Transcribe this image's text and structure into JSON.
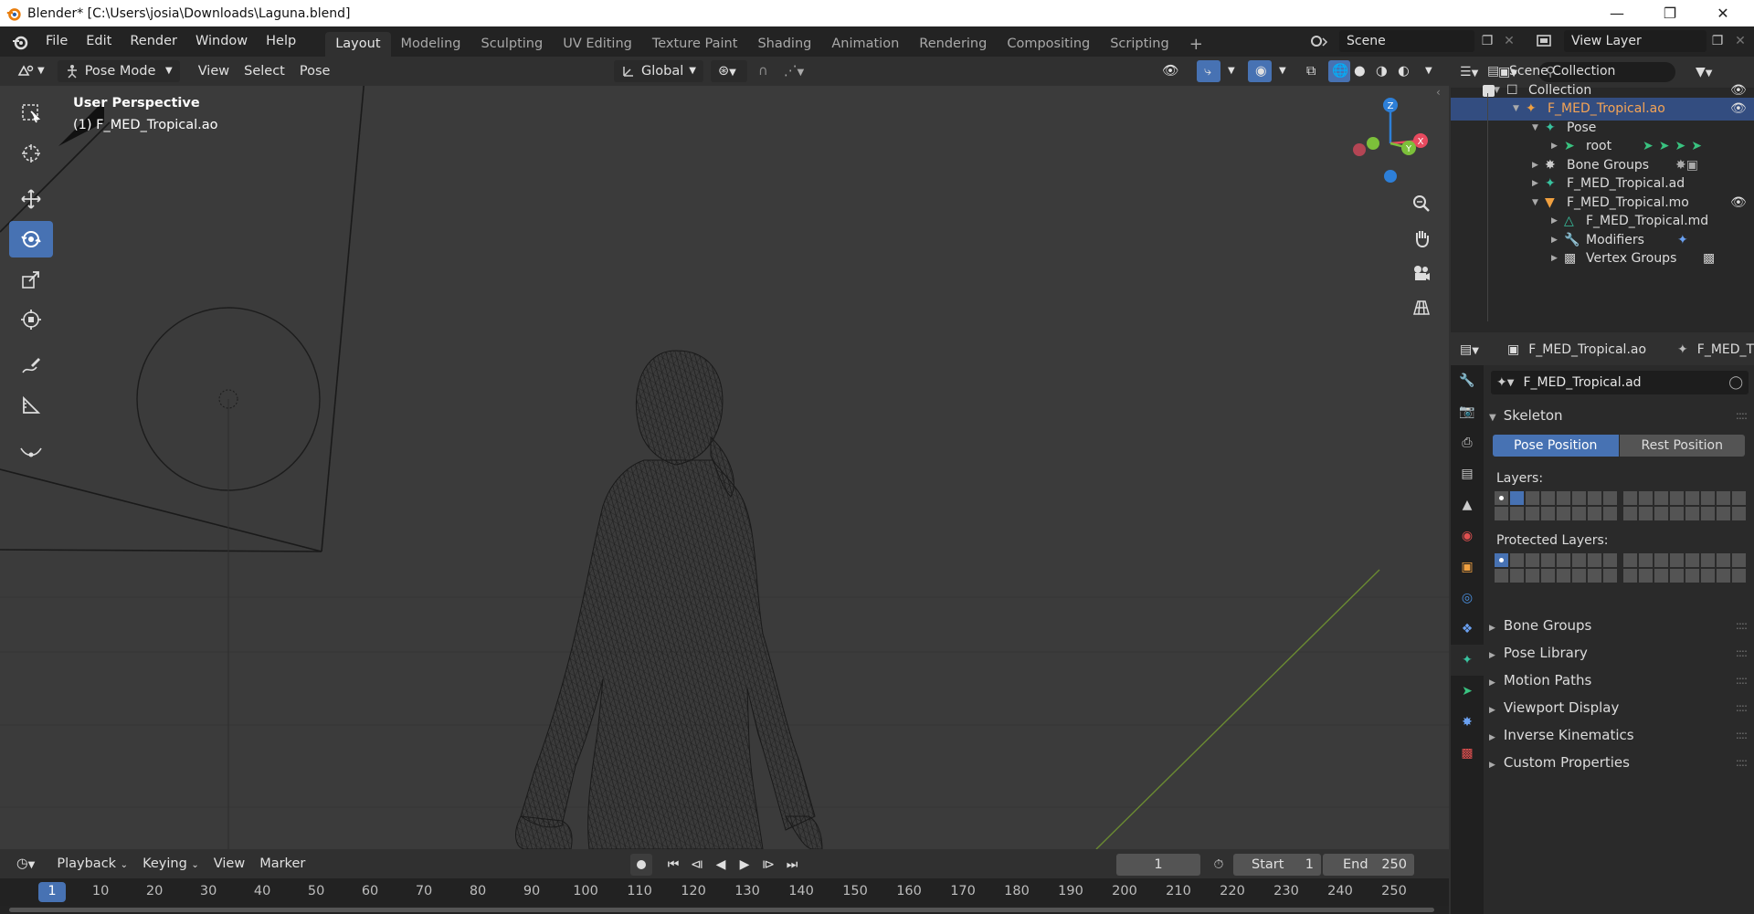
{
  "window": {
    "title": "Blender* [C:\\Users\\josia\\Downloads\\Laguna.blend]"
  },
  "menu": [
    "File",
    "Edit",
    "Render",
    "Window",
    "Help"
  ],
  "workspaces": [
    "Layout",
    "Modeling",
    "Sculpting",
    "UV Editing",
    "Texture Paint",
    "Shading",
    "Animation",
    "Rendering",
    "Compositing",
    "Scripting"
  ],
  "active_workspace": "Layout",
  "scene_name": "Scene",
  "view_layer_name": "View Layer",
  "viewport_header": {
    "mode": "Pose Mode",
    "menus": [
      "View",
      "Select",
      "Pose"
    ],
    "orientation": "Global"
  },
  "viewport": {
    "perspective_label": "User Perspective",
    "object_label": "(1) F_MED_Tropical.ao",
    "gizmo_axes": [
      "Z",
      "Y",
      "X"
    ]
  },
  "outliner": {
    "rows": [
      {
        "label": "Scene Collection",
        "indent": 0
      },
      {
        "label": "Collection",
        "indent": 1
      },
      {
        "label": "F_MED_Tropical.ao",
        "indent": 2,
        "highlight": true
      },
      {
        "label": "Pose",
        "indent": 3
      },
      {
        "label": "root",
        "indent": 4
      },
      {
        "label": "Bone Groups",
        "indent": 3
      },
      {
        "label": "F_MED_Tropical.ad",
        "indent": 3
      },
      {
        "label": "F_MED_Tropical.mo",
        "indent": 3
      },
      {
        "label": "F_MED_Tropical.md",
        "indent": 4
      },
      {
        "label": "Modifiers",
        "indent": 4
      },
      {
        "label": "Vertex Groups",
        "indent": 4
      }
    ]
  },
  "properties": {
    "breadcrumb_object": "F_MED_Tropical.ao",
    "breadcrumb_data": "F_MED_T",
    "data_name": "F_MED_Tropical.ad",
    "skeleton_title": "Skeleton",
    "pose_position": "Pose Position",
    "rest_position": "Rest Position",
    "layers_label": "Layers:",
    "protected_layers_label": "Protected Layers:",
    "panels": [
      "Bone Groups",
      "Pose Library",
      "Motion Paths",
      "Viewport Display",
      "Inverse Kinematics",
      "Custom Properties"
    ]
  },
  "timeline": {
    "menus": [
      "Playback",
      "Keying",
      "View",
      "Marker"
    ],
    "current_frame": "1",
    "start_label": "Start",
    "start_value": "1",
    "end_label": "End",
    "end_value": "250",
    "ruler": [
      "1",
      "10",
      "20",
      "30",
      "40",
      "50",
      "60",
      "70",
      "80",
      "90",
      "100",
      "110",
      "120",
      "130",
      "140",
      "150",
      "160",
      "170",
      "180",
      "190",
      "200",
      "210",
      "220",
      "230",
      "240",
      "250"
    ]
  },
  "colors": {
    "accent": "#4772b3",
    "active_object": "#f5a455",
    "axis_x": "#e84a5f",
    "axis_y": "#7cc03a",
    "axis_z": "#2d7fd8"
  }
}
